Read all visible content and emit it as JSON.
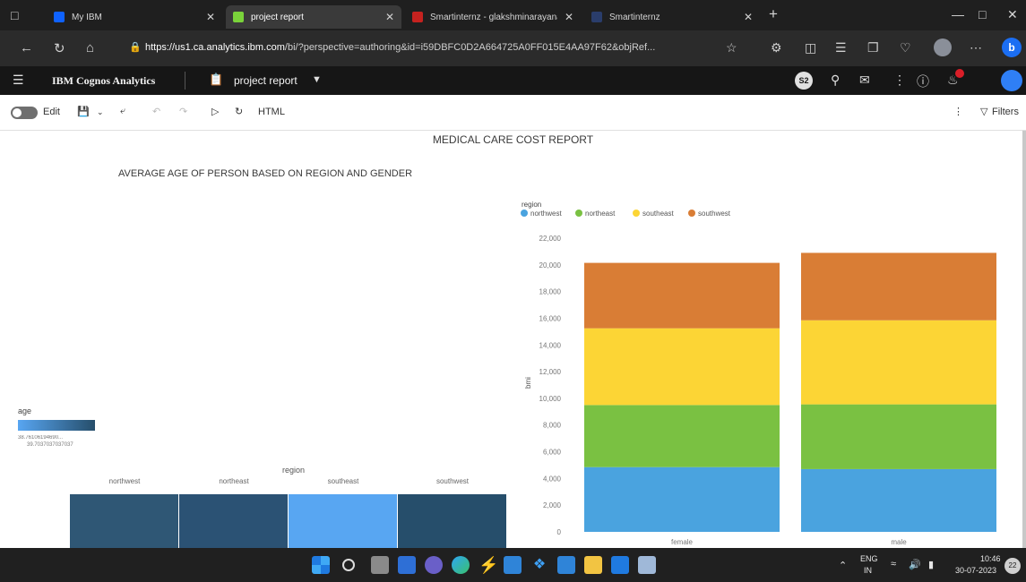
{
  "browser": {
    "tabs": [
      {
        "label": "My IBM",
        "color": "#0f62fe"
      },
      {
        "label": "project report",
        "color": "#7ad33a"
      },
      {
        "label": "Smartinternz - glakshminarayana",
        "color": "#c5221f"
      },
      {
        "label": "Smartinternz",
        "color": "#2a3d6b"
      }
    ],
    "url_host": "https://us1.ca.analytics.ibm.com",
    "url_rest": "/bi/?perspective=authoring&id=i59DBFC0D2A664725A0FF015E4AA97F62&objRef..."
  },
  "app": {
    "product": "IBM Cognos Analytics",
    "report_name": "project report",
    "badge": "S2"
  },
  "toolbar": {
    "edit_label": "Edit",
    "html_label": "HTML",
    "filters_label": "Filters"
  },
  "report": {
    "title": "MEDICAL CARE COST REPORT"
  },
  "heatmap": {
    "title": "AVERAGE AGE OF PERSON BASED ON REGION AND GENDER",
    "legend_title": "age",
    "legend_min": "38.76106194690...",
    "legend_max": "39.7037037037037",
    "axis_title": "region",
    "columns": [
      "northwest",
      "northeast",
      "southeast",
      "southwest"
    ],
    "cell_colors": [
      "#2f5775",
      "#2b5274",
      "#58a6f2",
      "#264e6b"
    ]
  },
  "chart_data": {
    "type": "bar",
    "stacked": true,
    "legend_title": "region",
    "legend_position": "top-left",
    "categories": [
      "female",
      "male"
    ],
    "series": [
      {
        "name": "northwest",
        "color": "#4aa3df",
        "values": [
          4850,
          4700
        ]
      },
      {
        "name": "northeast",
        "color": "#7ac142",
        "values": [
          4650,
          4850
        ]
      },
      {
        "name": "southeast",
        "color": "#fcd535",
        "values": [
          5750,
          6300
        ]
      },
      {
        "name": "southwest",
        "color": "#d97d35",
        "values": [
          4900,
          5050
        ]
      }
    ],
    "ylabel": "bmi",
    "ylim": [
      0,
      22000
    ],
    "yticks": [
      "0",
      "2,000",
      "4,000",
      "6,000",
      "8,000",
      "10,000",
      "12,000",
      "14,000",
      "16,000",
      "18,000",
      "20,000",
      "22,000"
    ],
    "grid": false
  },
  "taskbar": {
    "lang": "ENG",
    "region": "IN",
    "time": "10:46",
    "date": "30-07-2023",
    "notif_count": "22"
  }
}
